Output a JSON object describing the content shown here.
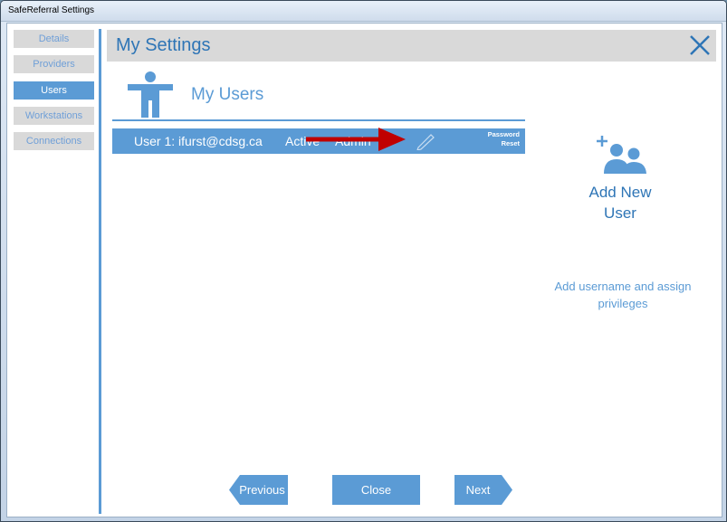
{
  "window": {
    "title": "SafeReferral Settings"
  },
  "nav": {
    "items": [
      {
        "label": "Details",
        "active": false
      },
      {
        "label": "Providers",
        "active": false
      },
      {
        "label": "Users",
        "active": true
      },
      {
        "label": "Workstations",
        "active": false
      },
      {
        "label": "Connections",
        "active": false
      }
    ]
  },
  "header": {
    "title": "My Settings",
    "close_icon": "close-x-icon"
  },
  "users_section": {
    "title": "My Users",
    "icon": "person-icon",
    "rows": [
      {
        "user": "User 1: ifurst@cdsg.ca",
        "status": "Active",
        "role": "Admin",
        "edit_icon": "pencil-icon",
        "password_reset": [
          "Password",
          "Reset"
        ]
      }
    ]
  },
  "add_user": {
    "label_line1": "Add New",
    "label_line2": "User",
    "description_line1": "Add username and assign",
    "description_line2": "privileges",
    "icon": "add-user-icon"
  },
  "footer": {
    "previous": "Previous",
    "close": "Close",
    "next": "Next"
  },
  "colors": {
    "accent": "#5b9bd5",
    "accent_dark": "#2e75b6",
    "nav_bg": "#d9d9d9",
    "arrow": "#c00000"
  }
}
